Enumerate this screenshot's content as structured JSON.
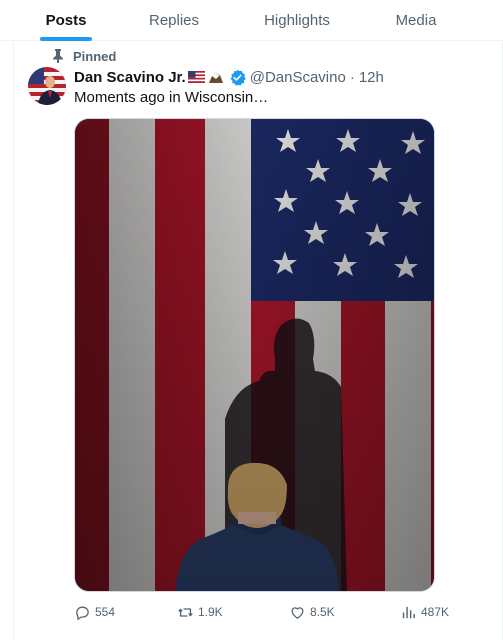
{
  "tabs": [
    {
      "label": "Posts",
      "active": true
    },
    {
      "label": "Replies",
      "active": false
    },
    {
      "label": "Highlights",
      "active": false
    },
    {
      "label": "Media",
      "active": false
    }
  ],
  "tweet": {
    "pinned_label": "Pinned",
    "display_name": "Dan Scavino Jr.",
    "handle": "@DanScavino",
    "separator": "·",
    "time": "12h",
    "text": "Moments ago in Wisconsin…",
    "verified": true
  },
  "actions": {
    "replies": "554",
    "reposts": "1.9K",
    "likes": "8.5K",
    "views": "487K"
  },
  "colors": {
    "accent": "#1d9bf0",
    "secondary_text": "#536471",
    "primary_text": "#0f1419"
  }
}
